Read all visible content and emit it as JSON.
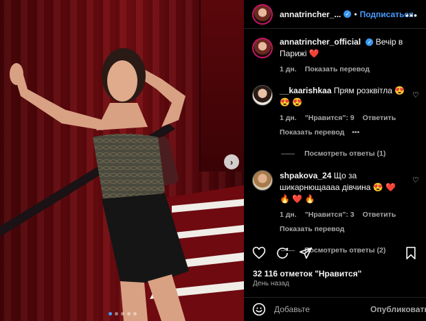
{
  "post": {
    "username": "annatrincher_...",
    "follow_label": "Подписаться",
    "more_label": "•••",
    "next_label": "›",
    "carousel_count": 5
  },
  "caption": {
    "username": "annatrincher_official",
    "text": "Вечір в Парижі",
    "emoji": "❤️",
    "time": "1 дн.",
    "translate": "Показать перевод"
  },
  "comments": [
    {
      "username": "__kaarishkaa",
      "text": "Прям розквітла",
      "emoji": "😍 😍 😍",
      "time": "1 дн.",
      "likes": "\"Нравится\": 9",
      "reply": "Ответить",
      "translate": "Показать перевод",
      "options": "•••",
      "view_replies": "Посмотреть ответы (1)"
    },
    {
      "username": "shpakova_24",
      "text": "Що за шикарнющаааа дівчина",
      "emoji": "😍 ❤️ 🔥 ❤️ 🔥",
      "time": "1 дн.",
      "likes": "\"Нравится\": 3",
      "reply": "Ответить",
      "translate": "Показать перевод",
      "view_replies": "Посмотреть ответы (2)"
    }
  ],
  "likes_count": "32 116 отметок \"Нравится\"",
  "date": "День назад",
  "composer": {
    "placeholder": "Добавьте",
    "publish": "Опубликовать"
  },
  "colors": {
    "accent": "#4a9bff",
    "verified": "#3897f0",
    "muted": "#a8a8a8",
    "background": "#000000"
  },
  "icons": [
    "heart-icon",
    "comment-icon",
    "share-icon",
    "bookmark-icon",
    "emoji-icon",
    "verified-icon",
    "more-icon",
    "chevron-right-icon"
  ]
}
